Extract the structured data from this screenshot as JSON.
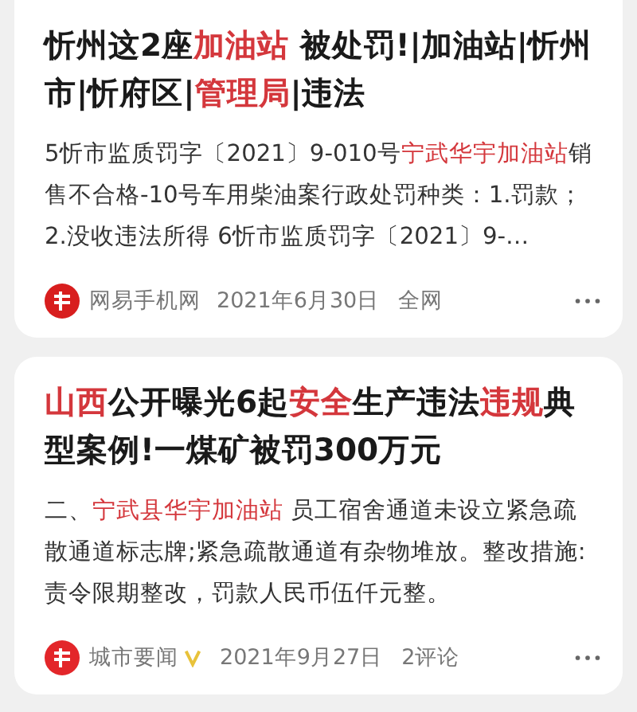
{
  "articles": [
    {
      "title": [
        {
          "text": "忻州这2座",
          "highlight": false
        },
        {
          "text": "加油站",
          "highlight": true
        },
        {
          "text": " 被处罚!|加油站|忻州市|忻府区|",
          "highlight": false
        },
        {
          "text": "管理局",
          "highlight": true
        },
        {
          "text": "|违法",
          "highlight": false
        }
      ],
      "snippet": [
        {
          "text": "5忻市监质罚字〔2021〕9-010号",
          "highlight": false
        },
        {
          "text": "宁武华宇加油站",
          "highlight": true
        },
        {
          "text": "销售不合格-10号车用柴油案行政处罚种类：1.罚款；2.没收违法所得 6忻市监质罚字〔2021〕9-…",
          "highlight": false
        }
      ],
      "source": {
        "kind": "netease",
        "name": "网易手机网",
        "verified": false
      },
      "date": "2021年6月30日",
      "extra": "全网"
    },
    {
      "title": [
        {
          "text": "山西",
          "highlight": true
        },
        {
          "text": "公开曝光6起",
          "highlight": false
        },
        {
          "text": "安全",
          "highlight": true
        },
        {
          "text": "生产违法",
          "highlight": false
        },
        {
          "text": "违规",
          "highlight": true
        },
        {
          "text": "典型案例!一煤矿被罚300万元",
          "highlight": false
        }
      ],
      "snippet": [
        {
          "text": "二、",
          "highlight": false
        },
        {
          "text": "宁武县华宇加油站",
          "highlight": true
        },
        {
          "text": " 员工宿舍通道未设立紧急疏散通道标志牌;紧急疏散通道有杂物堆放。整改措施:责令限期整改，罚款人民币伍仟元整。",
          "highlight": false
        }
      ],
      "source": {
        "kind": "toutiao",
        "name": "城市要闻",
        "verified": true
      },
      "date": "2021年9月27日",
      "extra": "2评论"
    }
  ]
}
